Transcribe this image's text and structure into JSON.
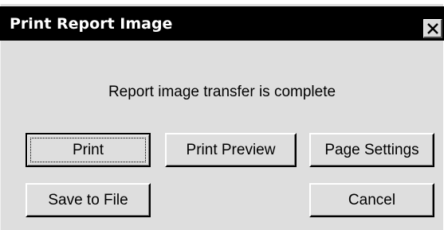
{
  "dialog": {
    "title": "Print Report Image",
    "close_icon": "close-icon",
    "message": "Report image transfer is complete"
  },
  "buttons": {
    "print": "Print",
    "print_preview": "Print Preview",
    "page_settings": "Page Settings",
    "save_to_file": "Save to File",
    "cancel": "Cancel"
  }
}
